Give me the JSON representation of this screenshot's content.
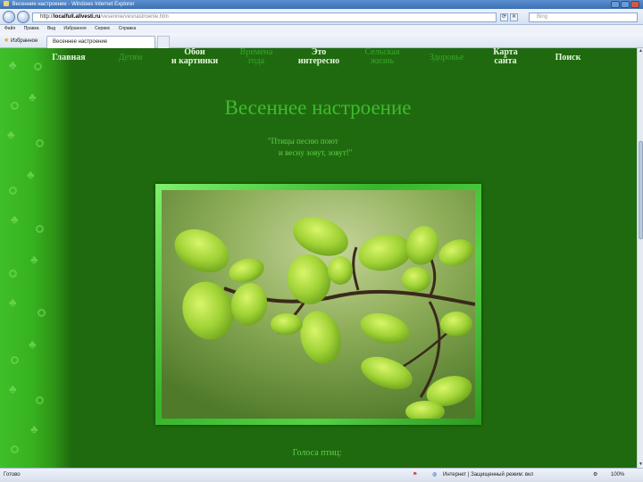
{
  "browser": {
    "window_title": "Весенние настроение - Windows Internet Explorer",
    "url_prefix": "http://",
    "url_host": "localfull.allvesti.ru",
    "url_path": "/vesennie/vesnastroenie.htm",
    "search_placeholder": "Bing",
    "menu": [
      "Файл",
      "Правка",
      "Вид",
      "Избранное",
      "Сервис",
      "Справка"
    ],
    "favorites_label": "Избранное",
    "tab_label": "Весеннее настроение"
  },
  "site": {
    "nav": [
      {
        "line1": "Главная",
        "line2": ""
      },
      {
        "line1": "Детям",
        "line2": ""
      },
      {
        "line1": "Обои",
        "line2": "и картинки"
      },
      {
        "line1": "Времена",
        "line2": "года"
      },
      {
        "line1": "Это",
        "line2": "интересно"
      },
      {
        "line1": "Сельская",
        "line2": "жизнь"
      },
      {
        "line1": "Здоровье",
        "line2": ""
      },
      {
        "line1": "Карта",
        "line2": "сайта"
      },
      {
        "line1": "Поиск",
        "line2": ""
      }
    ],
    "page_title": "Весеннее настроение",
    "quote_line1": "\"Птицы песню поют",
    "quote_line2": "и весну зовут, зовут!\"",
    "bottom_heading": "Голоса птиц:"
  },
  "status": {
    "left": "Готово",
    "zone": "Интернет | Защищенный режим: вкл",
    "zoom": "100%"
  },
  "colors": {
    "page_background": "#1f6a0e",
    "title_green": "#3fbb2e",
    "nav_active": "#e6f6de",
    "nav_dim": "#36a62a"
  }
}
